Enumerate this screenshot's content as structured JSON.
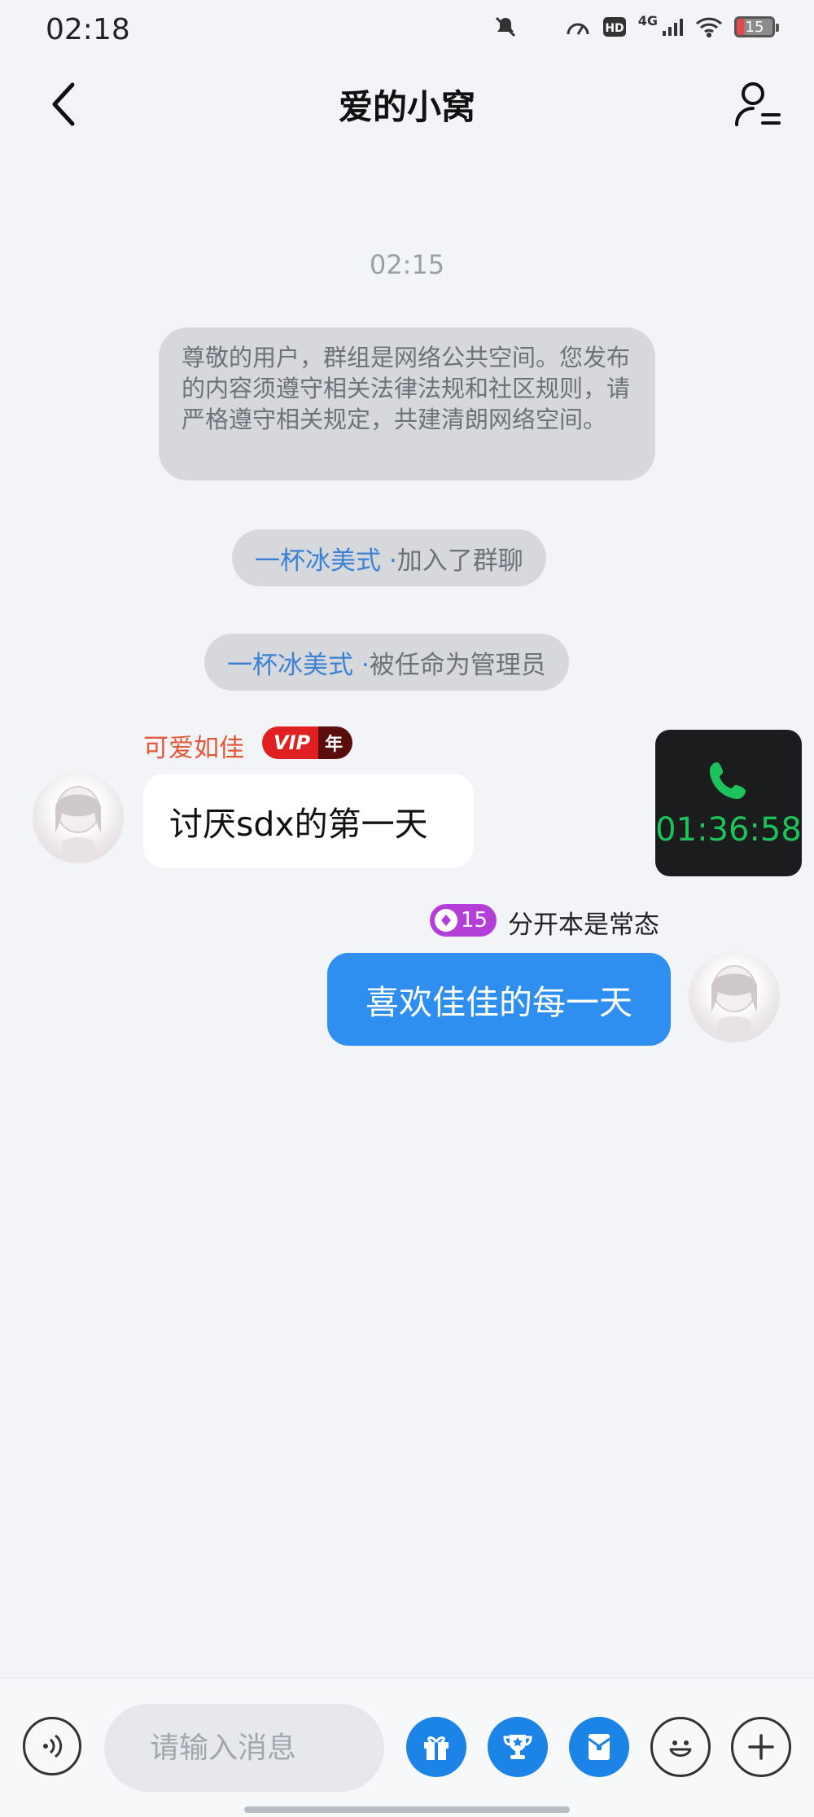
{
  "status_bar": {
    "time": "02:18",
    "network": "4G",
    "battery": "15",
    "icons": [
      "mute-icon",
      "moon-icon",
      "speed-icon",
      "hd-icon",
      "signal-icon",
      "wifi-icon",
      "battery-icon"
    ]
  },
  "header": {
    "title": "爱的小窝",
    "back_icon": "chevron-left-icon",
    "profile_icon": "group-members-icon"
  },
  "chat": {
    "timestamp": "02:15",
    "notice": "尊敬的用户，群组是网络公共空间。您发布的内容须遵守相关法律法规和社区规则，请严格遵守相关规定，共建清朗网络空间。",
    "system_messages": [
      {
        "name": "一杯冰美式 · ",
        "text": "加入了群聊"
      },
      {
        "name": "一杯冰美式 · ",
        "text": "被任命为管理员"
      }
    ],
    "messages": [
      {
        "sender": "可爱如佳",
        "vip_label": "VIP",
        "vip_suffix": "年",
        "text": "讨厌sdx的第一天",
        "side": "left"
      },
      {
        "level": "15",
        "signature": "分开本是常态",
        "text": "喜欢佳佳的每一天",
        "side": "right"
      }
    ]
  },
  "call_widget": {
    "duration": "01:36:58",
    "accent": "#1ec25a"
  },
  "input_bar": {
    "placeholder": "请输入消息",
    "buttons": [
      "voice-icon",
      "gift-icon",
      "trophy-icon",
      "red-packet-icon",
      "emoji-icon",
      "plus-icon"
    ],
    "accent": "#1b84e6"
  }
}
